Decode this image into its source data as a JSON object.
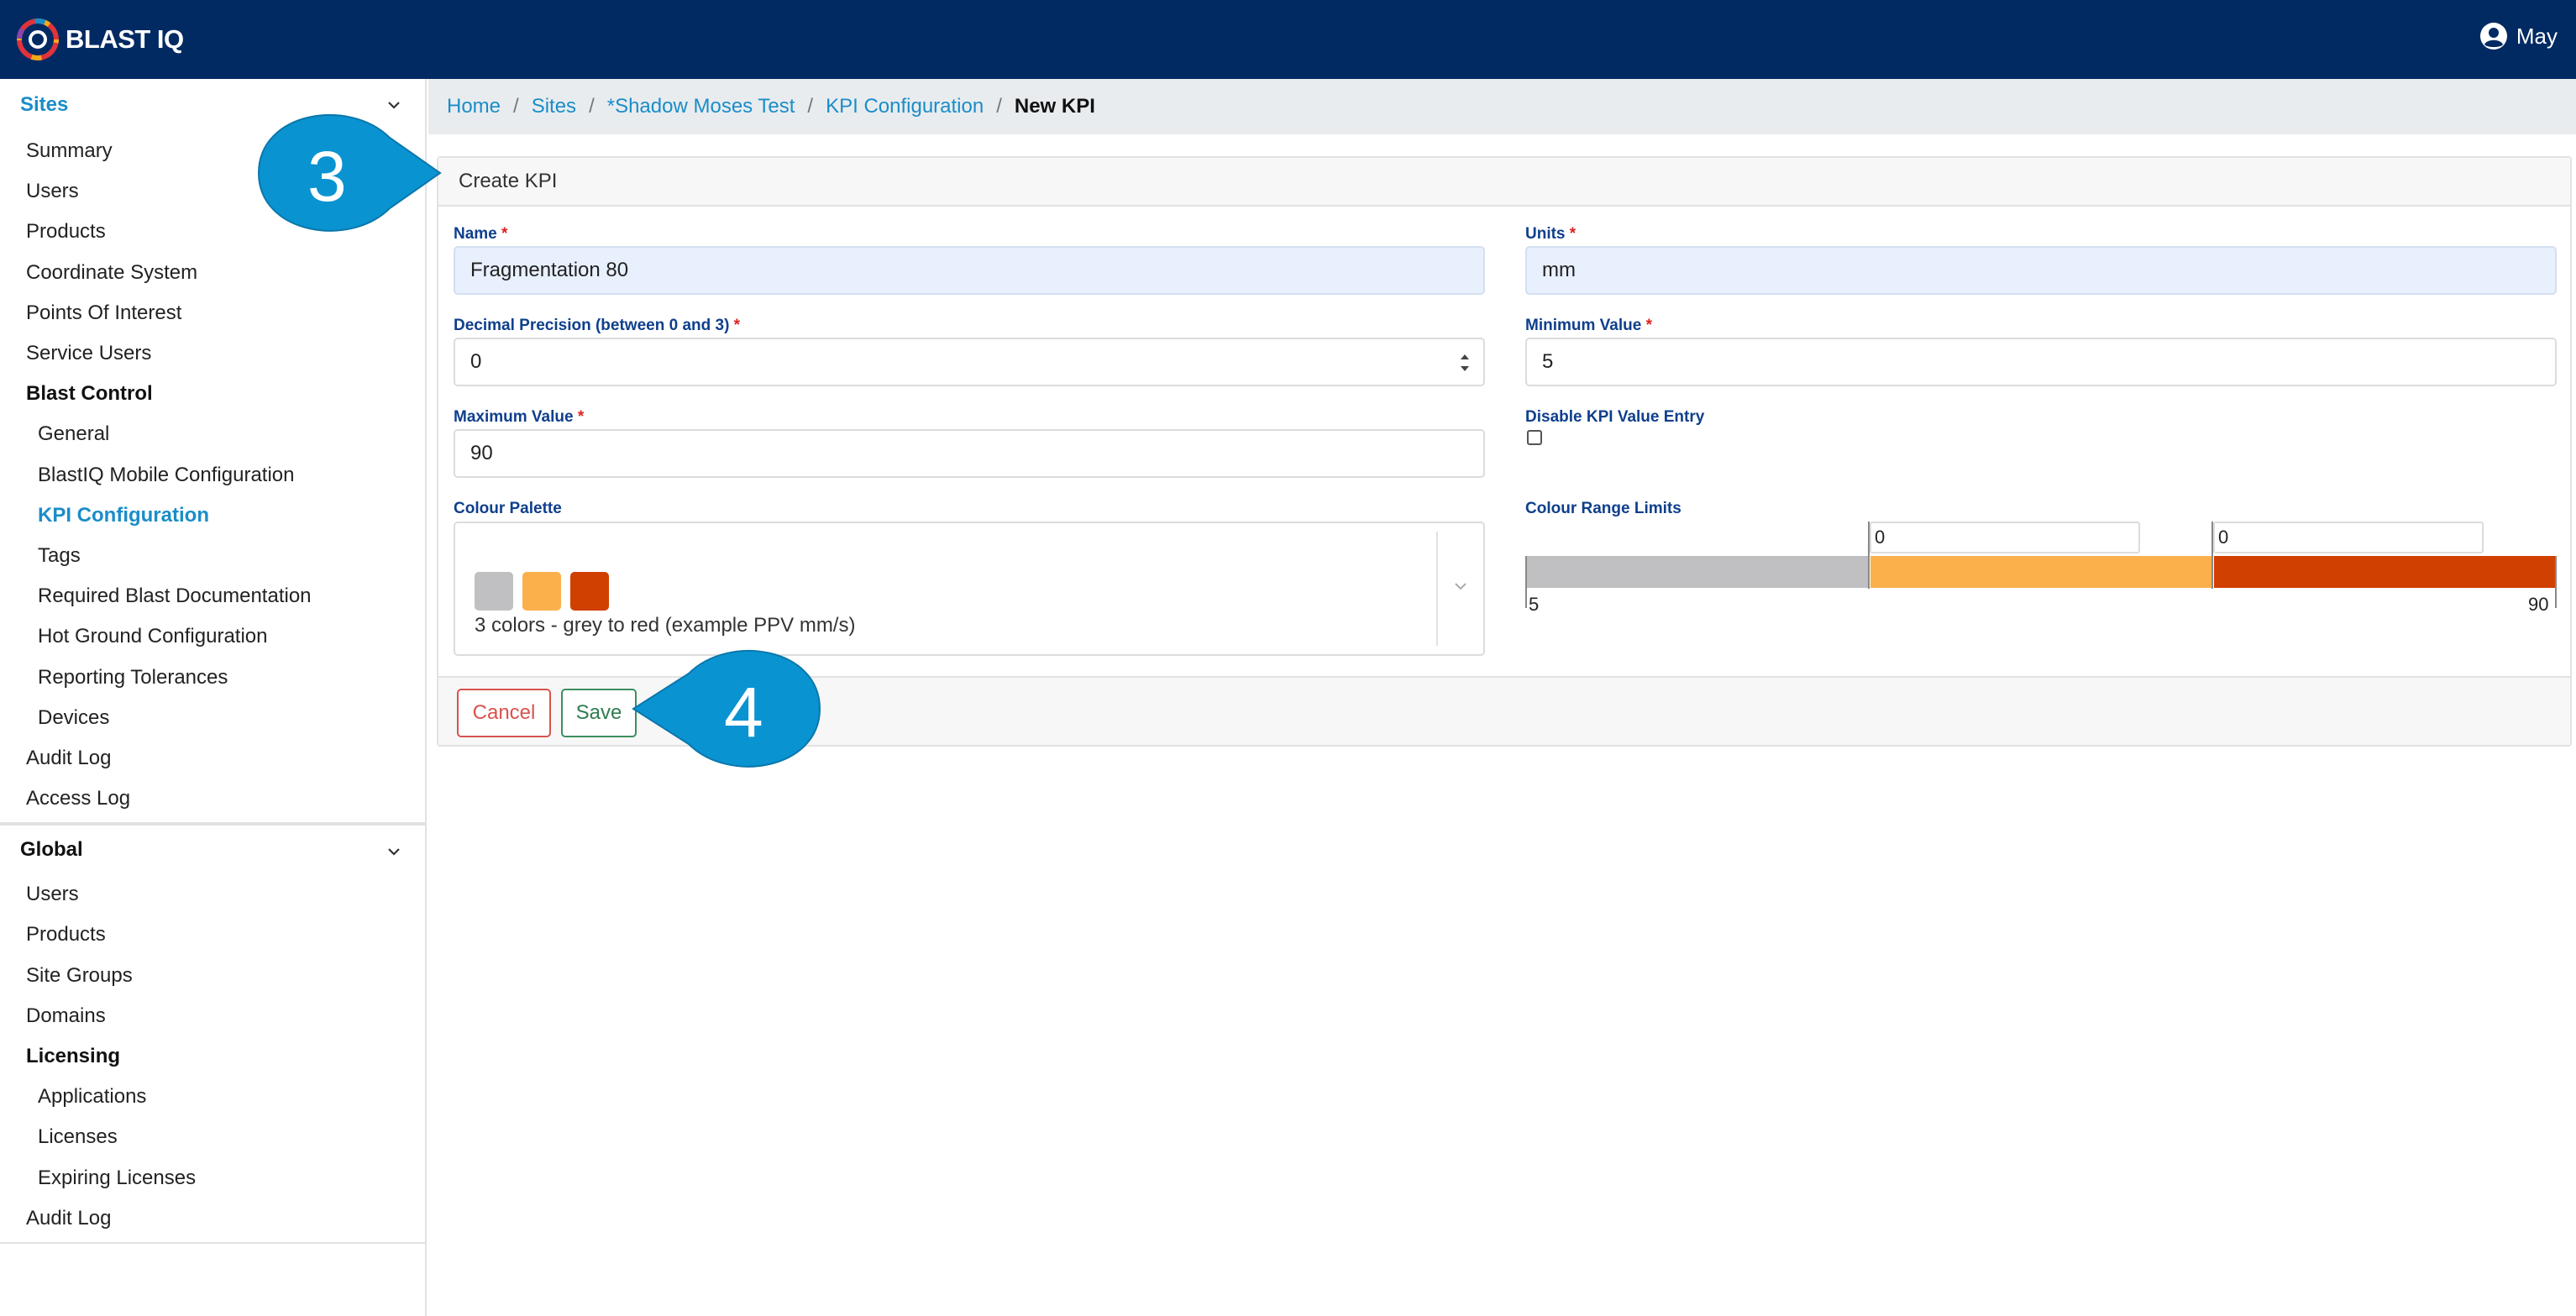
{
  "app": {
    "logo_text": "BLAST IQ",
    "user_name": "May"
  },
  "sidebar": {
    "sites_header": "Sites",
    "sites_items": [
      {
        "label": "Summary",
        "kind": "item"
      },
      {
        "label": "Users",
        "kind": "item"
      },
      {
        "label": "Products",
        "kind": "item"
      },
      {
        "label": "Coordinate System",
        "kind": "item"
      },
      {
        "label": "Points Of Interest",
        "kind": "item"
      },
      {
        "label": "Service Users",
        "kind": "item"
      },
      {
        "label": "Blast Control",
        "kind": "group"
      },
      {
        "label": "General",
        "kind": "sub"
      },
      {
        "label": "BlastIQ Mobile Configuration",
        "kind": "sub"
      },
      {
        "label": "KPI Configuration",
        "kind": "sub-active"
      },
      {
        "label": "Tags",
        "kind": "sub"
      },
      {
        "label": "Required Blast Documentation",
        "kind": "sub"
      },
      {
        "label": "Hot Ground Configuration",
        "kind": "sub"
      },
      {
        "label": "Reporting Tolerances",
        "kind": "sub"
      },
      {
        "label": "Devices",
        "kind": "sub"
      },
      {
        "label": "Audit Log",
        "kind": "item"
      },
      {
        "label": "Access Log",
        "kind": "item"
      }
    ],
    "global_header": "Global",
    "global_items": [
      {
        "label": "Users",
        "kind": "item"
      },
      {
        "label": "Products",
        "kind": "item"
      },
      {
        "label": "Site Groups",
        "kind": "item"
      },
      {
        "label": "Domains",
        "kind": "item"
      },
      {
        "label": "Licensing",
        "kind": "group"
      },
      {
        "label": "Applications",
        "kind": "sub"
      },
      {
        "label": "Licenses",
        "kind": "sub"
      },
      {
        "label": "Expiring Licenses",
        "kind": "sub"
      },
      {
        "label": "Audit Log",
        "kind": "item"
      }
    ]
  },
  "breadcrumb": {
    "items": [
      "Home",
      "Sites",
      "*Shadow Moses Test",
      "KPI Configuration"
    ],
    "separator": "/",
    "current": "New KPI"
  },
  "form": {
    "title": "Create KPI",
    "required_mark": "*",
    "name_label": "Name",
    "name_value": "Fragmentation 80",
    "units_label": "Units",
    "units_value": "mm",
    "precision_label": "Decimal Precision (between 0 and 3)",
    "precision_value": "0",
    "min_label": "Minimum Value",
    "min_value": "5",
    "max_label": "Maximum Value",
    "max_value": "90",
    "disable_label": "Disable KPI Value Entry",
    "disable_checked": false,
    "palette_label": "Colour Palette",
    "palette_text": "3 colors - grey to red (example PPV mm/s)",
    "palette_colors": [
      "#c0c0c2",
      "#fbb04c",
      "#d04000"
    ],
    "range_label": "Colour Range Limits",
    "range_limit_1": "0",
    "range_limit_2": "0",
    "range_start": "5",
    "range_end": "90",
    "cancel_label": "Cancel",
    "save_label": "Save"
  },
  "callouts": {
    "step_a": "3",
    "step_b": "4",
    "color": "#0a93d1"
  }
}
